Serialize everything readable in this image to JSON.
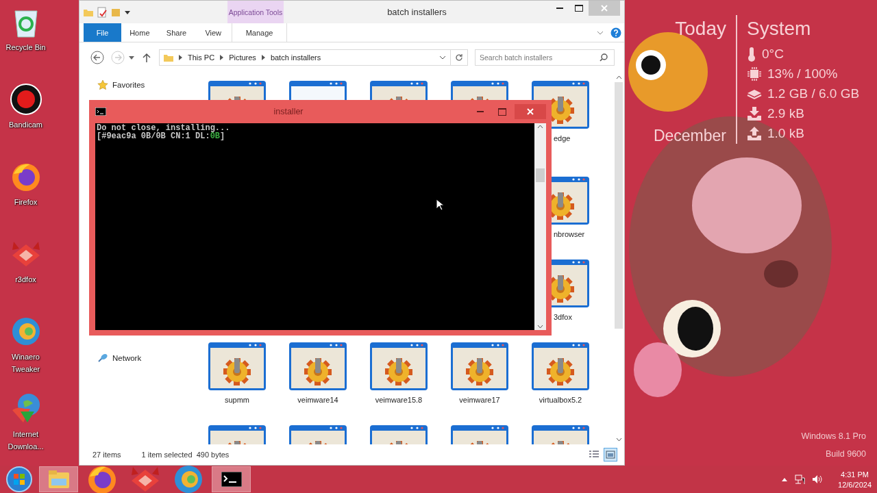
{
  "desktop_icons": [
    {
      "label": "Recycle Bin",
      "kind": "recycle"
    },
    {
      "label": "Bandicam",
      "kind": "record"
    },
    {
      "label": "Firefox",
      "kind": "firefox"
    },
    {
      "label": "r3dfox",
      "kind": "r3dfox"
    },
    {
      "label": "Winaero Tweaker",
      "kind": "swirl"
    },
    {
      "label": "Internet Downloa...",
      "kind": "download"
    }
  ],
  "explorer": {
    "title": "batch installers",
    "context_tab": "Application Tools",
    "ribbon_tabs": [
      {
        "label": "File",
        "kind": "file"
      },
      {
        "label": "Home",
        "kind": "plain"
      },
      {
        "label": "Share",
        "kind": "plain"
      },
      {
        "label": "View",
        "kind": "plain"
      },
      {
        "label": "Manage",
        "kind": "context"
      }
    ],
    "breadcrumb": [
      "This PC",
      "Pictures",
      "batch installers"
    ],
    "search": {
      "placeholder": "Search batch installers"
    },
    "nav_groups": [
      {
        "label": "Favorites",
        "kind": "star"
      },
      {
        "label": "Network",
        "kind": "network"
      }
    ],
    "file_rows": [
      {
        "items": [
          {
            "kind": "app"
          },
          {
            "kind": "blank"
          },
          {
            "kind": "app"
          },
          {
            "kind": "app"
          },
          {
            "kind": "app",
            "label": "edge",
            "partial": true
          }
        ]
      },
      {
        "items": [
          {
            "kind": "app",
            "label": "nbrowser",
            "partial": true
          }
        ]
      },
      {
        "items": [
          {
            "kind": "app",
            "label": "3dfox",
            "partial": true
          }
        ]
      },
      {
        "items": [
          {
            "kind": "app",
            "label": "supmm",
            "partial": false
          },
          {
            "kind": "app",
            "label": "veimware14",
            "partial": false
          },
          {
            "kind": "app",
            "label": "veimware15.8",
            "partial": false
          },
          {
            "kind": "app",
            "label": "veimware17",
            "partial": false
          },
          {
            "kind": "app",
            "label": "virtualbox5.2",
            "partial": false
          }
        ]
      },
      {
        "items": [
          {
            "kind": "app"
          },
          {
            "kind": "app"
          },
          {
            "kind": "app"
          },
          {
            "kind": "app"
          },
          {
            "kind": "app"
          }
        ]
      }
    ],
    "status": {
      "count": "27 items",
      "selection": "1 item selected  490 bytes"
    },
    "views": [
      {
        "kind": "details",
        "selected": false
      },
      {
        "kind": "large",
        "selected": true
      }
    ]
  },
  "console": {
    "title": "installer",
    "lines": [
      {
        "segments": [
          {
            "text": "Do not close, installing..."
          }
        ]
      },
      {
        "segments": [
          {
            "text": "[#9eac9a 0B/0B CN:1 DL:"
          },
          {
            "text": "0B",
            "color": "#3cb043"
          },
          {
            "text": "]"
          }
        ]
      }
    ]
  },
  "widget": {
    "today": {
      "heading": "Today",
      "date": "December"
    },
    "system": {
      "heading": "System",
      "stats": [
        {
          "kind": "temperature",
          "value": "0°C"
        },
        {
          "kind": "cpu",
          "value": "13% / 100%"
        },
        {
          "kind": "memory",
          "value": "1.2 GB / 6.0 GB"
        },
        {
          "kind": "download",
          "value": "2.9 kB"
        },
        {
          "kind": "upload",
          "value": "1.0 kB"
        }
      ]
    }
  },
  "watermark": [
    "Windows 8.1 Pro",
    "Build 9600"
  ],
  "taskbar": {
    "items": [
      {
        "kind": "explorer",
        "active": true
      },
      {
        "kind": "firefox",
        "active": false
      },
      {
        "kind": "r3dfox",
        "active": false
      },
      {
        "kind": "swirl",
        "active": false
      },
      {
        "kind": "console",
        "active": true
      }
    ],
    "clock": {
      "time": "4:31 PM",
      "date": "12/6/2024"
    }
  }
}
